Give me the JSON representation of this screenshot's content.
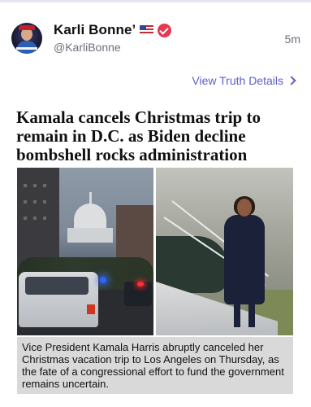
{
  "post": {
    "display_name": "Karli Bonne’",
    "handle": "@KarliBonne",
    "time": "5m",
    "view_details_label": "View Truth Details"
  },
  "article": {
    "headline": "Kamala cancels Christmas trip to remain in D.C. as Biden decline bombshell rocks administration",
    "caption": "Vice President Kamala Harris abruptly canceled her Christmas vacation trip to Los Angeles on Thursday, as the fate of a congressional effort to fund the government remains uncertain."
  },
  "icons": {
    "flag": "us-flag-icon",
    "verified": "verified-badge-icon",
    "chevron": "chevron-right-icon"
  },
  "colors": {
    "accent": "#5b5fc7",
    "verified": "#e8384f",
    "caption_bg": "#d9d9d9"
  }
}
